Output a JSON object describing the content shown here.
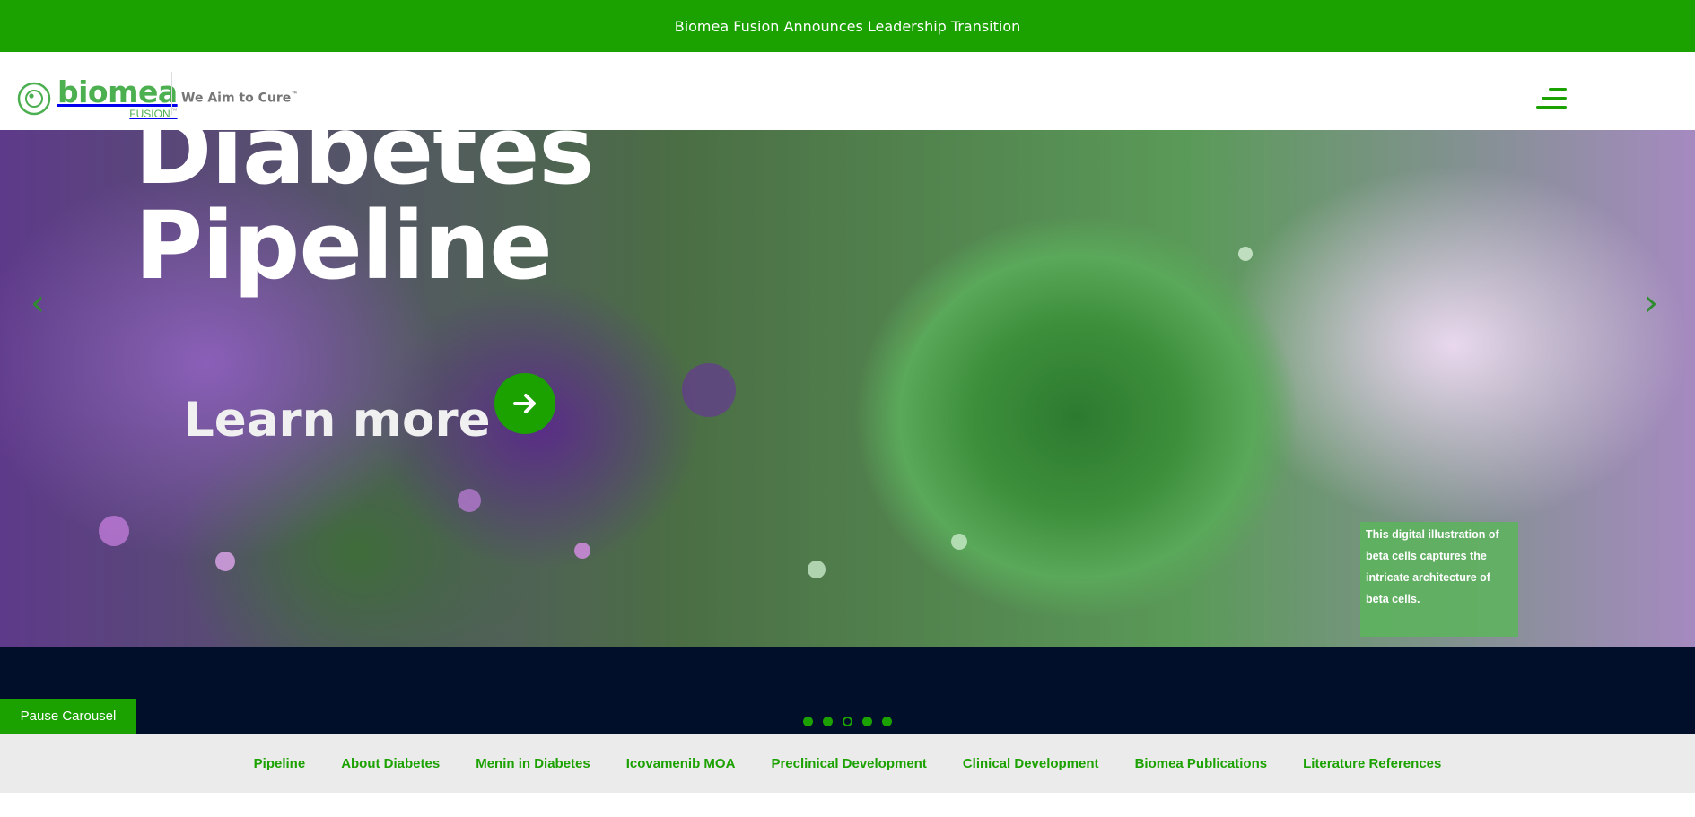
{
  "announcement": {
    "text": "Biomea Fusion Announces Leadership Transition"
  },
  "header": {
    "logo_word": "biomea",
    "logo_sub": "FUSION",
    "logo_tm": "™",
    "tagline": "We Aim to Cure",
    "tagline_tm": "™"
  },
  "hero": {
    "title_line1": "Diabetes",
    "title_line2": "Pipeline",
    "learn_more": "Learn more",
    "caption": "This digital illustration of beta cells captures the intricate architecture of beta cells.",
    "prev_glyph": "‹",
    "next_glyph": "›"
  },
  "carousel": {
    "pause_label": "Pause Carousel",
    "slide_count": 5,
    "active_slide": 3
  },
  "subnav": {
    "items": [
      "Pipeline",
      "About Diabetes",
      "Menin in Diabetes",
      "Icovamenib MOA",
      "Preclinical Development",
      "Clinical Development",
      "Biomea Publications",
      "Literature References"
    ]
  },
  "colors": {
    "brand_green": "#1ba100",
    "logo_green": "#4caf50",
    "dark_navy": "#010f2a",
    "subnav_bg": "#ebebeb"
  },
  "icons": {
    "menu": "hamburger-menu-icon",
    "arrow": "arrow-right-icon",
    "prev": "chevron-left-icon",
    "next": "chevron-right-icon"
  }
}
